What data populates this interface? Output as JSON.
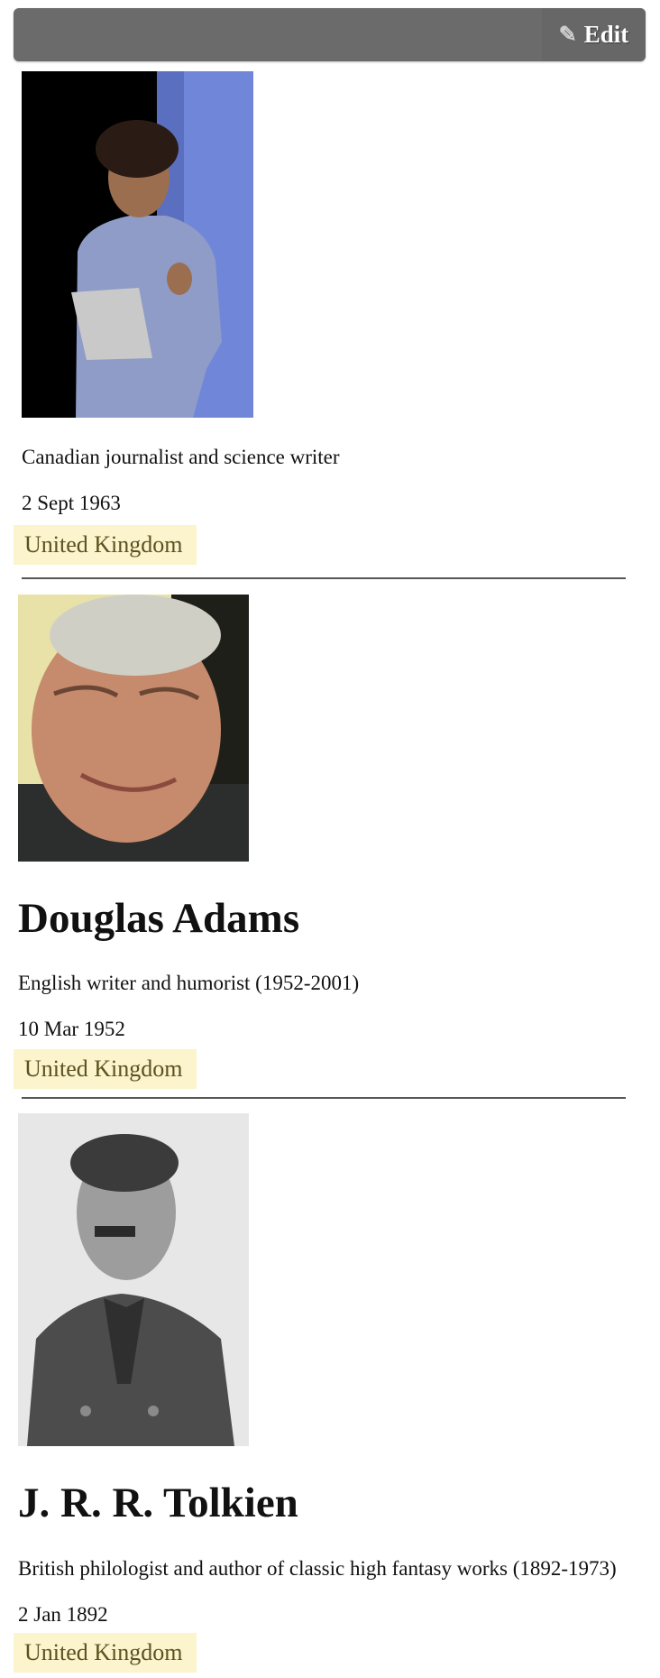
{
  "toolbar": {
    "edit_label": "Edit",
    "edit_icon": "pencil-icon"
  },
  "people": [
    {
      "name": "",
      "bio": "Canadian journalist and science writer",
      "born": "2 Sept 1963",
      "country": "United Kingdom"
    },
    {
      "name": "Douglas Adams",
      "bio": "English writer and humorist (1952-2001)",
      "born": "10 Mar 1952",
      "country": "United Kingdom"
    },
    {
      "name": "J. R. R. Tolkien",
      "bio": "British philologist and author of classic high fantasy works (1892-1973)",
      "born": "2 Jan 1892",
      "country": "United Kingdom"
    }
  ],
  "colors": {
    "toolbar": "#6b6b6b",
    "country_badge": "#fbf4cc",
    "divider": "#555555"
  }
}
